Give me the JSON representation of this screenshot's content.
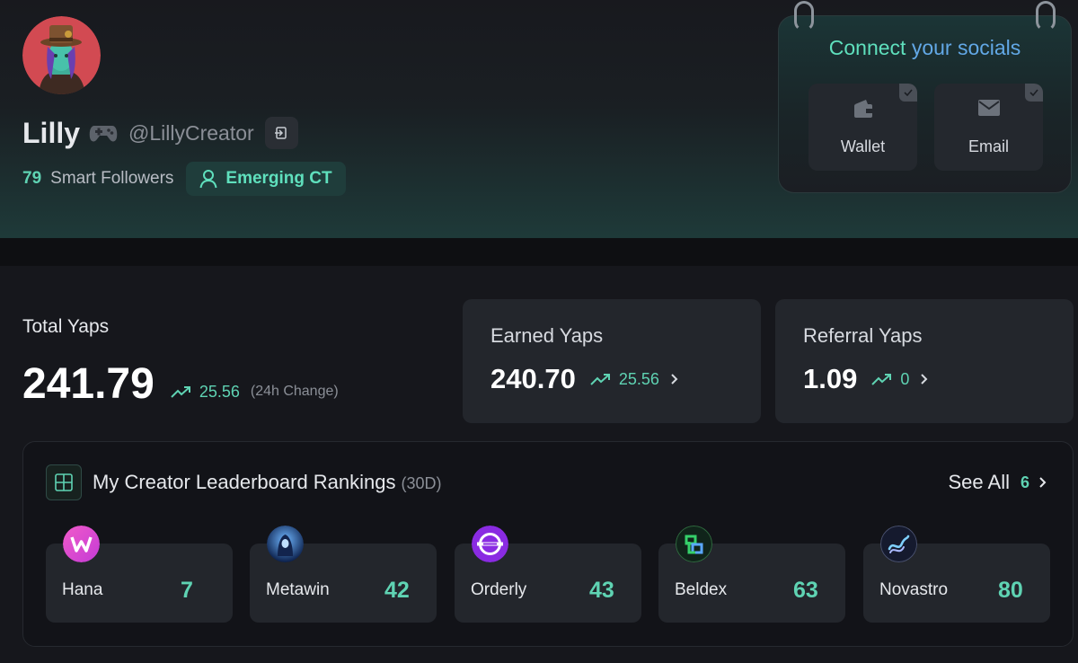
{
  "profile": {
    "name": "Lilly",
    "handle": "@LillyCreator",
    "smart_followers_count": "79",
    "smart_followers_label": "Smart Followers",
    "badge": "Emerging CT"
  },
  "socials": {
    "title_part1": "Connect",
    "title_part2": "your socials",
    "items": [
      {
        "label": "Wallet",
        "icon": "wallet-icon"
      },
      {
        "label": "Email",
        "icon": "envelope-icon"
      }
    ]
  },
  "total_yaps": {
    "label": "Total Yaps",
    "value": "241.79",
    "change": "25.56",
    "change_note": "(24h Change)"
  },
  "earned_yaps": {
    "label": "Earned Yaps",
    "value": "240.70",
    "change": "25.56"
  },
  "referral_yaps": {
    "label": "Referral Yaps",
    "value": "1.09",
    "change": "0"
  },
  "leaderboard": {
    "title": "My Creator Leaderboard Rankings",
    "period": "(30D)",
    "see_all_label": "See All",
    "see_all_count": "6",
    "rankings": [
      {
        "name": "Hana",
        "rank": "7"
      },
      {
        "name": "Metawin",
        "rank": "42"
      },
      {
        "name": "Orderly",
        "rank": "43"
      },
      {
        "name": "Beldex",
        "rank": "63"
      },
      {
        "name": "Novastro",
        "rank": "80"
      }
    ]
  },
  "colors": {
    "accent": "#5fd3b3",
    "accent_blue": "#62a8e6",
    "card": "#23262c",
    "background": "#16171c"
  }
}
